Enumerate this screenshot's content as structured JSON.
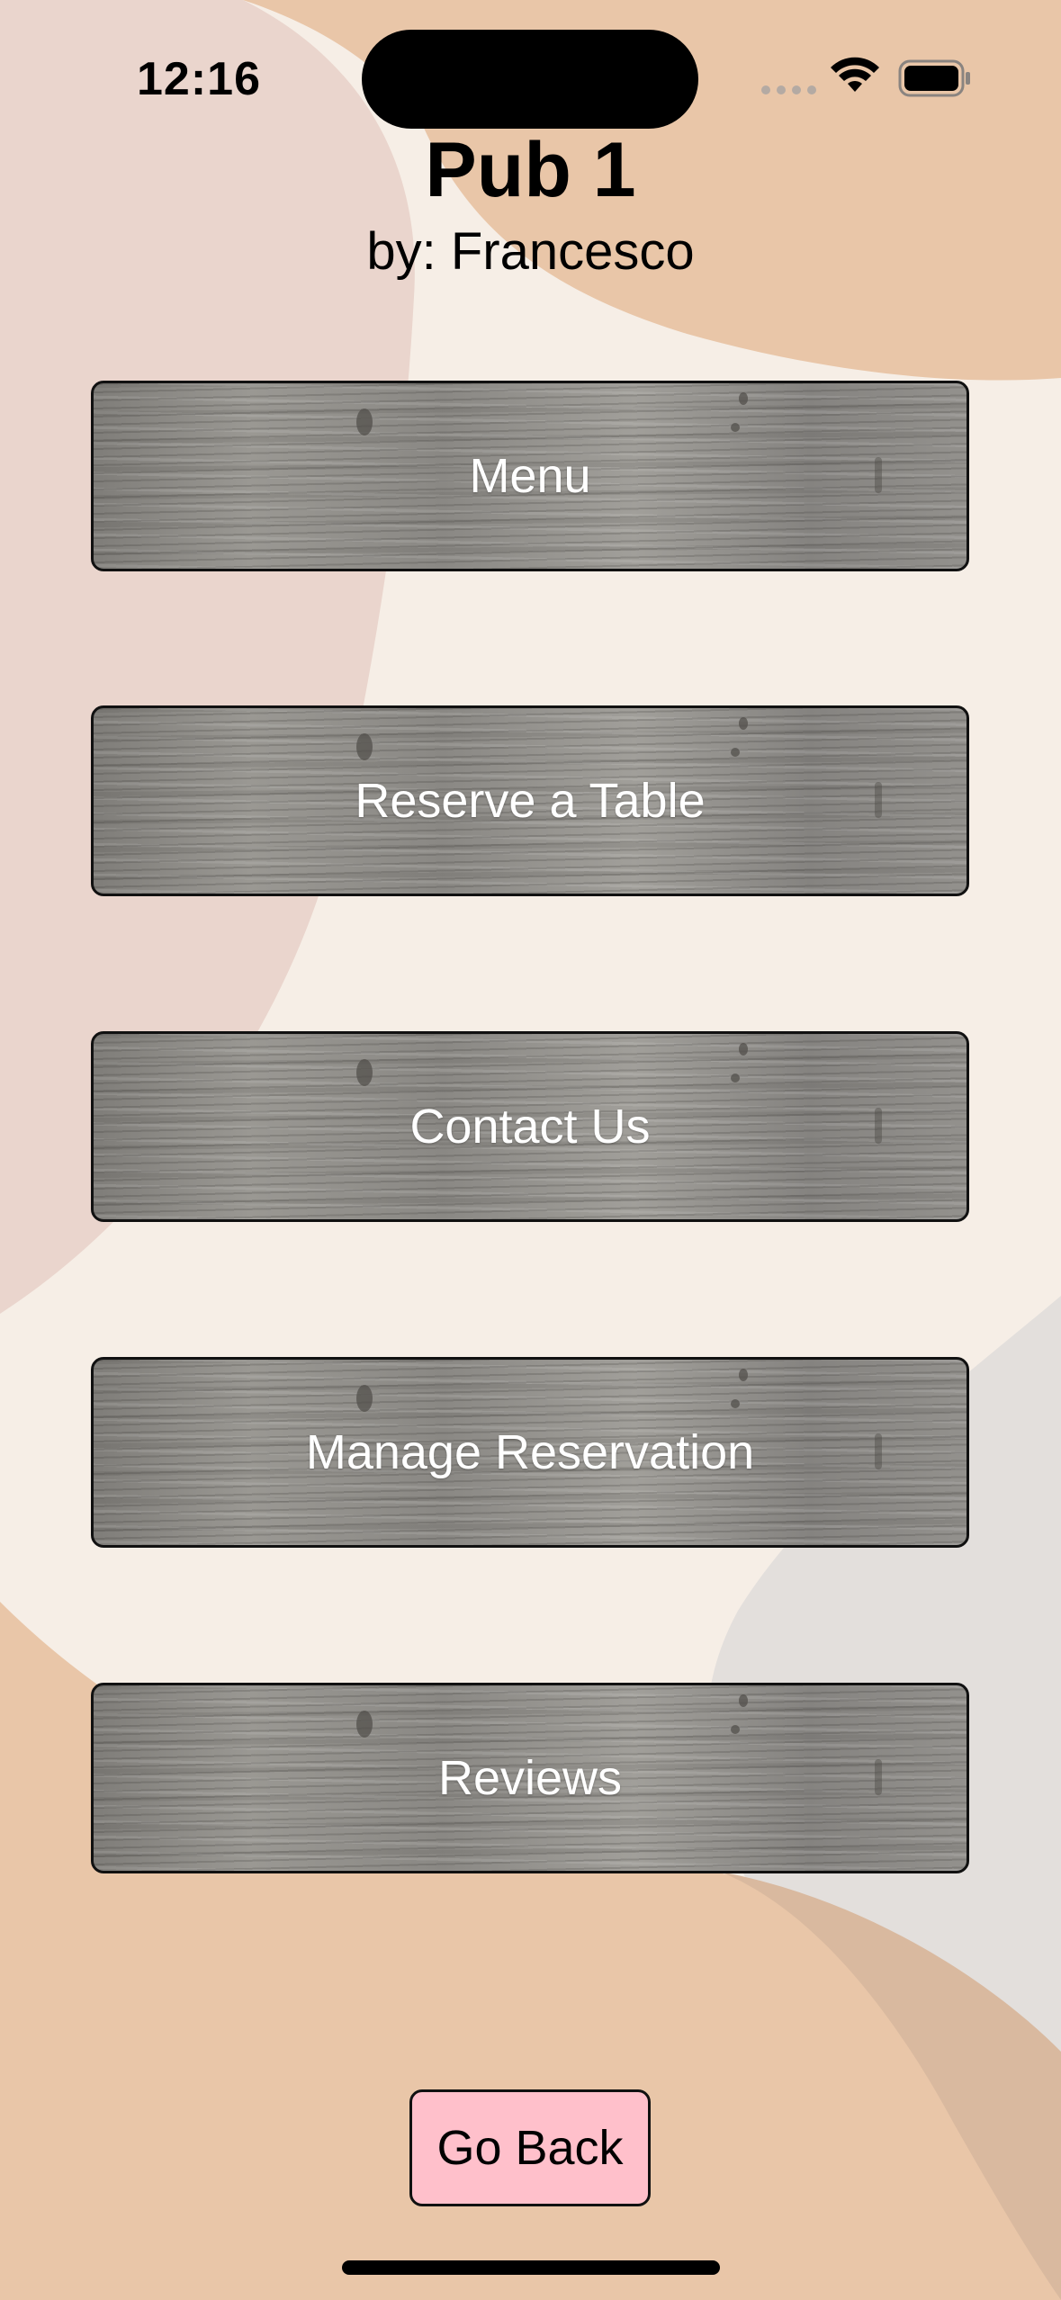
{
  "status_bar": {
    "time": "12:16"
  },
  "header": {
    "title": "Pub 1",
    "subtitle": "by: Francesco"
  },
  "buttons": [
    {
      "label": "Menu"
    },
    {
      "label": "Reserve a Table"
    },
    {
      "label": "Contact Us"
    },
    {
      "label": "Manage Reservation"
    },
    {
      "label": "Reviews"
    }
  ],
  "footer": {
    "go_back_label": "Go Back"
  },
  "colors": {
    "background_cream": "#f6eee6",
    "shape_peach": "#e9c6a8",
    "shape_pink": "#ead5cd",
    "shape_grey": "#e3dfdc",
    "go_back_fill": "#ffc0cb",
    "button_text": "#ffffff"
  },
  "icons": [
    "cellular-signal-icon",
    "wifi-icon",
    "battery-icon"
  ]
}
